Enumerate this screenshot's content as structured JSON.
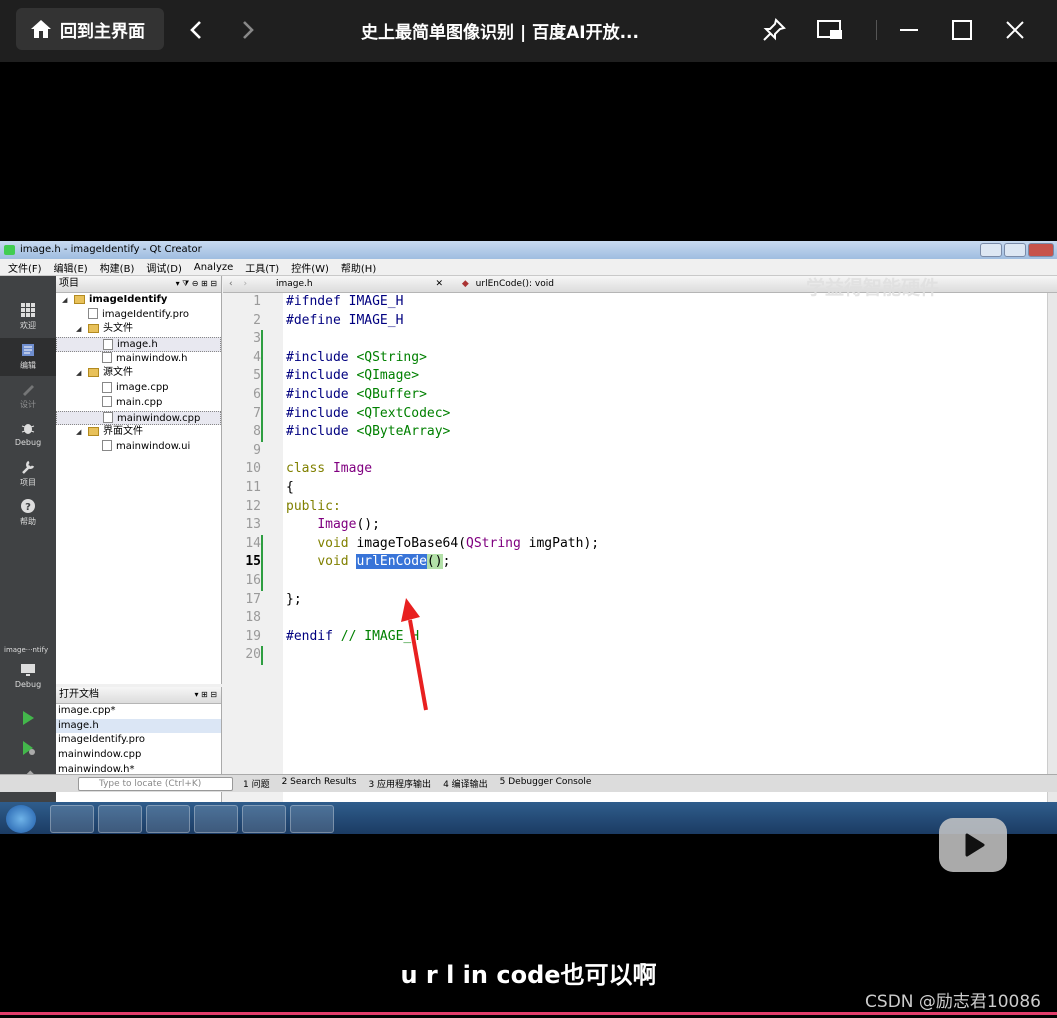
{
  "window": {
    "home_label": "回到主界面",
    "title": "史上最简单图像识别 | 百度AI开放..."
  },
  "qt": {
    "title": "image.h - imageIdentify - Qt Creator",
    "menu": [
      "文件(F)",
      "编辑(E)",
      "构建(B)",
      "调试(D)",
      "Analyze",
      "工具(T)",
      "控件(W)",
      "帮助(H)"
    ],
    "modes": [
      "欢迎",
      "编辑",
      "设计",
      "Debug",
      "项目",
      "帮助"
    ],
    "kit_label": "image···ntify",
    "kit_mode": "Debug",
    "project_header": "项目",
    "tree": {
      "root": "imageIdentify",
      "pro": "imageIdentify.pro",
      "headers_folder": "头文件",
      "headers": [
        "image.h",
        "mainwindow.h"
      ],
      "sources_folder": "源文件",
      "sources": [
        "image.cpp",
        "main.cpp",
        "mainwindow.cpp"
      ],
      "forms_folder": "界面文件",
      "forms": [
        "mainwindow.ui"
      ]
    },
    "open_docs_header": "打开文档",
    "open_docs": [
      "image.cpp*",
      "image.h",
      "imageIdentify.pro",
      "mainwindow.cpp",
      "mainwindow.h*"
    ],
    "editor_file": "image.h",
    "editor_symbol": "urlEnCode(): void",
    "line_numbers": [
      "1",
      "2",
      "3",
      "4",
      "5",
      "6",
      "7",
      "8",
      "9",
      "10",
      "11",
      "12",
      "13",
      "14",
      "15",
      "16",
      "17",
      "18",
      "19",
      "20"
    ],
    "current_line": "15",
    "code": {
      "l1": "#ifndef IMAGE_H",
      "l2": "#define IMAGE_H",
      "inc_kw": "#include",
      "inc": [
        "<QString>",
        "<QImage>",
        "<QBuffer>",
        "<QTextCodec>",
        "<QByteArray>"
      ],
      "class_kw": "class",
      "class_name": "Image",
      "open_brace": "{",
      "public_kw": "public:",
      "ctor": "Image",
      "ctor_rest": "();",
      "void_kw": "void",
      "fn1": "imageToBase64(",
      "fn1_type": "QString",
      "fn1_rest": " imgPath);",
      "fn2": "urlEnCode",
      "fn2_parens": "()",
      "fn2_semi": ";",
      "close": "};",
      "endif": "#endif",
      "endif_comment": "// IMAGE_H"
    },
    "locate_placeholder": "Type to locate (Ctrl+K)",
    "output_tabs": [
      "1 问题",
      "2 Search Results",
      "3 应用程序输出",
      "4 编译输出",
      "5 Debugger Console"
    ]
  },
  "watermark": "学益得智能硬件",
  "subtitle": "u r l in code也可以啊",
  "csdn_credit": "CSDN @励志君10086"
}
